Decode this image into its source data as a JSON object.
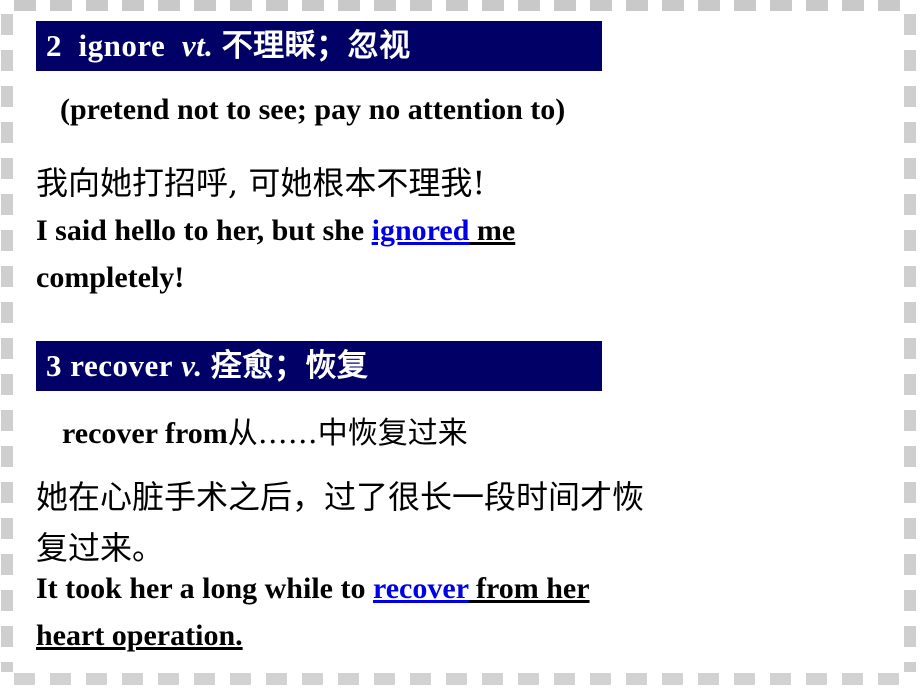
{
  "slide": {
    "background_color": "#ffffff",
    "border_style": "dashed-gray-filmstrip",
    "border_color": "#cfcfcf",
    "header_bar_color": "#000066",
    "header_text_color": "#ffffff",
    "keyword_color": "#0000e6",
    "body_text_color": "#000000"
  },
  "entries": [
    {
      "number": "2",
      "header": {
        "index": "2",
        "word": "ignore",
        "pos": "vt.",
        "meaning_cn": "不理睬；忽视",
        "full": "2  ignore  vt. 不理睬；忽视"
      },
      "definition_en": "(pretend not to see; pay no attention to)",
      "example_cn": "我向她打招呼, 可她根本不理我!",
      "example_en": {
        "before": "I said hello to her,  but she ",
        "keyword": "ignored",
        "after": " me",
        "line2": "completely!"
      }
    },
    {
      "number": "3",
      "header": {
        "index": "3",
        "word": "recover",
        "pos": "v.",
        "meaning_cn": "痊愈；恢复",
        "full": "3 recover v. 痊愈；恢复"
      },
      "phrase": "recover from从……中恢复过来",
      "phrase_parts": {
        "en": "recover from",
        "cn": "从……中恢复过来"
      },
      "example_cn_line1": "她在心脏手术之后，过了很长一段时间才恢",
      "example_cn_line2": "复过来。",
      "example_en": {
        "before": "It took her a long while to ",
        "keyword": "recover",
        "after": " from her",
        "line2": "heart operation."
      }
    }
  ]
}
